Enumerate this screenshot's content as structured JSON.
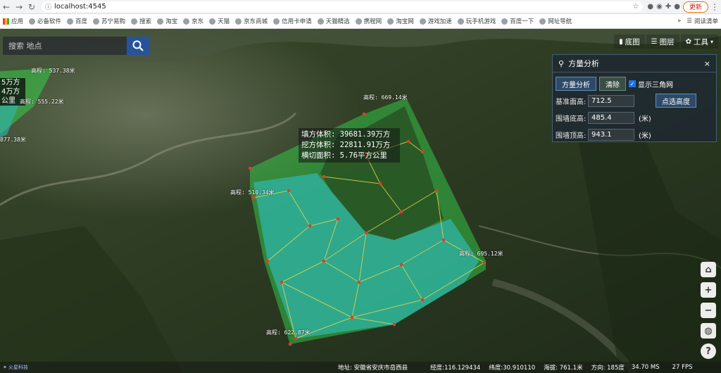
{
  "browser": {
    "url": "localhost:4545",
    "update_label": "更新"
  },
  "bookmarks": [
    "应用",
    "必备软件",
    "百度",
    "苏宁易购",
    "搜索",
    "淘宝",
    "京东",
    "天猫",
    "京东商城",
    "信用卡申请",
    "天猫精选",
    "携程网",
    "淘宝网",
    "游戏加速",
    "玩手机游戏",
    "百度一下",
    "网址导航"
  ],
  "bookmarks_more": "»",
  "reading_list": "阅读清单",
  "search": {
    "placeholder": "搜索 地点"
  },
  "toolbar": {
    "basemap": "底图",
    "layers": "图层",
    "tools": "工具"
  },
  "panel": {
    "title": "方量分析",
    "close": "×",
    "analyze_btn": "方量分析",
    "clear_btn": "清除",
    "show_tin_label": "显示三角网",
    "rows": [
      {
        "label": "基准面高:",
        "value": "712.5",
        "unit": "(米)"
      },
      {
        "label": "围墙底高:",
        "value": "485.4",
        "unit": "(米)"
      },
      {
        "label": "围墙顶高:",
        "value": "943.1",
        "unit": "(米)"
      }
    ],
    "pick_height_btn": "点选高度"
  },
  "map_labels": {
    "fill_volume": "填方体积: 39681.39万方",
    "cut_volume": "挖方体积: 22811.91万方",
    "cross_area": "横切面积: 5.76平方公里",
    "h1": "高程: 669.14米",
    "h2": "高程: 510.34米",
    "h3": "高程: 695.12米",
    "h4": "高程: 622.87米",
    "h5": "高程: 537.38米",
    "h6": "高程: 555.22米",
    "h7": "877.38米"
  },
  "left_info": [
    "5万方",
    "4万方",
    "公里"
  ],
  "status": {
    "address": "地址: 安徽省安庆市岳西县",
    "lng": "经度:116.129434",
    "lat": "纬度:30.910110",
    "alt": "海拔: 761.1米",
    "heading": "方向: 185度",
    "ms": "34.70 MS",
    "fps": "27 FPS",
    "logo": "火星科技"
  },
  "colors": {
    "accent": "#26539a",
    "fill": "#2fb8b0",
    "wall": "#35d04a",
    "point": "#e8382a",
    "line": "#e3d44a"
  }
}
